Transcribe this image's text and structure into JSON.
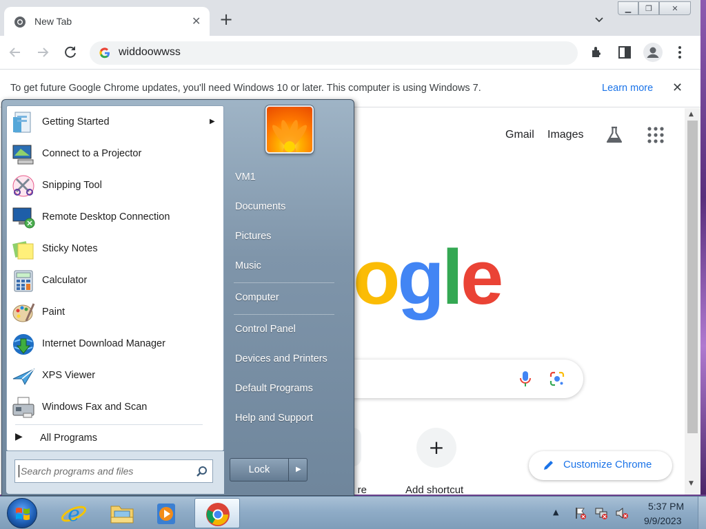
{
  "browser": {
    "tab": {
      "title": "New Tab"
    },
    "omnibox": {
      "value": "widdoowwss"
    },
    "infobar": {
      "message": "To get future Google Chrome updates, you'll need Windows 10 or later. This computer is using Windows 7.",
      "link": "Learn more"
    },
    "ntp": {
      "gmail": "Gmail",
      "images": "Images",
      "logo_visible": "ogle",
      "shortcuts": [
        {
          "label": "re"
        },
        {
          "label": "Add shortcut"
        }
      ],
      "customize": "Customize Chrome"
    }
  },
  "startmenu": {
    "programs": [
      {
        "label": "Getting Started",
        "icon": "getting-started-icon",
        "has_submenu": true
      },
      {
        "label": "Connect to a Projector",
        "icon": "projector-icon"
      },
      {
        "label": "Snipping Tool",
        "icon": "scissors-icon"
      },
      {
        "label": "Remote Desktop Connection",
        "icon": "remote-desktop-icon"
      },
      {
        "label": "Sticky Notes",
        "icon": "sticky-notes-icon"
      },
      {
        "label": "Calculator",
        "icon": "calculator-icon"
      },
      {
        "label": "Paint",
        "icon": "paint-palette-icon"
      },
      {
        "label": "Internet Download Manager",
        "icon": "idm-globe-icon"
      },
      {
        "label": "XPS Viewer",
        "icon": "xps-viewer-icon"
      },
      {
        "label": "Windows Fax and Scan",
        "icon": "fax-icon"
      }
    ],
    "all_programs": "All Programs",
    "search_placeholder": "Search programs and files",
    "places": [
      "VM1",
      "Documents",
      "Pictures",
      "Music",
      "Computer",
      "Control Panel",
      "Devices and Printers",
      "Default Programs",
      "Help and Support"
    ],
    "lock_label": "Lock"
  },
  "taskbar": {
    "time": "5:37 PM",
    "date": "9/9/2023",
    "pinned": [
      "internet-explorer-icon",
      "file-explorer-icon",
      "media-player-icon",
      "chrome-icon"
    ]
  },
  "colors": {
    "google_blue": "#4285f4",
    "google_red": "#ea4335",
    "google_yellow": "#fbbc05",
    "google_green": "#34a853",
    "link_blue": "#1a73e8"
  }
}
